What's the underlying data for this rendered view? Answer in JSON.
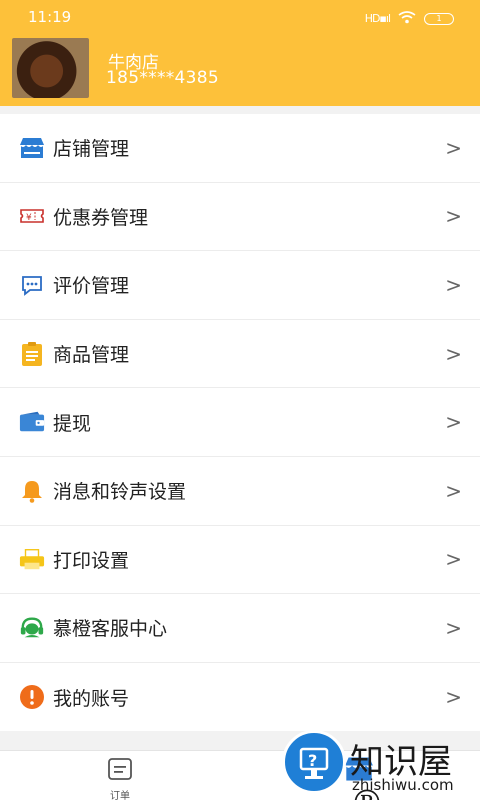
{
  "status": {
    "time": "11:19",
    "signal": "HD▪ıl",
    "battery": "1"
  },
  "profile": {
    "shop_name": "牛肉店",
    "phone": "185****4385"
  },
  "menu": [
    {
      "label": "店铺管理",
      "icon": "store-icon",
      "color": "#2b7cd3"
    },
    {
      "label": "优惠券管理",
      "icon": "coupon-icon",
      "color": "#c9302c"
    },
    {
      "label": "评价管理",
      "icon": "comment-icon",
      "color": "#2b6cc4"
    },
    {
      "label": "商品管理",
      "icon": "clipboard-icon",
      "color": "#f5b520"
    },
    {
      "label": "提现",
      "icon": "wallet-icon",
      "color": "#3a86d6"
    },
    {
      "label": "消息和铃声设置",
      "icon": "bell-icon",
      "color": "#f59a1e"
    },
    {
      "label": "打印设置",
      "icon": "printer-icon",
      "color": "#f5c518"
    },
    {
      "label": "慕橙客服中心",
      "icon": "headset-icon",
      "color": "#2ea84a"
    },
    {
      "label": "我的账号",
      "icon": "alert-icon",
      "color": "#ef6c1a"
    }
  ],
  "chevron": ">",
  "tabbar": {
    "orders_label": "订单"
  },
  "watermark": {
    "title": "知识屋®",
    "subtitle": "zhishiwu.com"
  },
  "colors": {
    "header": "#fdc13a"
  }
}
